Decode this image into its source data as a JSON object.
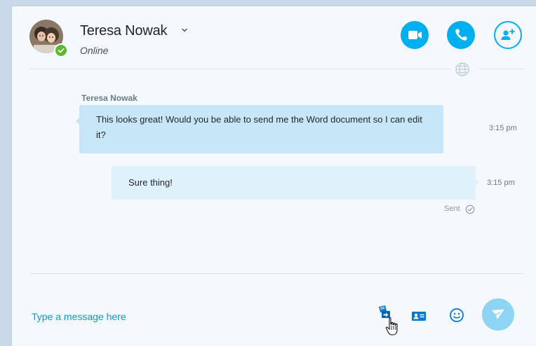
{
  "header": {
    "contact_name": "Teresa Nowak",
    "status": "Online",
    "presence_color": "#5cb82e",
    "accent_color": "#00aff0",
    "actions": [
      {
        "name": "video-call",
        "icon": "video-camera-icon"
      },
      {
        "name": "audio-call",
        "icon": "phone-icon"
      },
      {
        "name": "add-people",
        "icon": "add-person-icon"
      }
    ]
  },
  "conversation": {
    "messages": [
      {
        "sender": "Teresa Nowak",
        "direction": "incoming",
        "text": "This looks great! Would you be able to send me the Word document so I can edit it?",
        "time": "3:15 pm"
      },
      {
        "sender": "",
        "direction": "outgoing",
        "text": "Sure thing!",
        "time": "3:15 pm",
        "status": "Sent"
      }
    ]
  },
  "compose": {
    "placeholder": "Type a message here",
    "tools": [
      {
        "name": "send-file",
        "icon": "file-send-icon"
      },
      {
        "name": "send-contact",
        "icon": "contact-card-icon"
      },
      {
        "name": "emoticons",
        "icon": "smiley-icon"
      },
      {
        "name": "send",
        "icon": "send-arrow-icon"
      }
    ]
  }
}
